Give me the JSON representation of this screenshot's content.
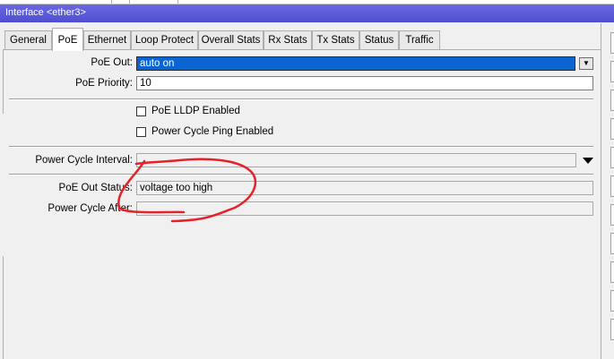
{
  "window": {
    "title": "Interface <ether3>"
  },
  "tabs": [
    {
      "label": "General",
      "active": false
    },
    {
      "label": "PoE",
      "active": true
    },
    {
      "label": "Ethernet",
      "active": false
    },
    {
      "label": "Loop Protect",
      "active": false
    },
    {
      "label": "Overall Stats",
      "active": false
    },
    {
      "label": "Rx Stats",
      "active": false
    },
    {
      "label": "Tx Stats",
      "active": false
    },
    {
      "label": "Status",
      "active": false
    },
    {
      "label": "Traffic",
      "active": false
    }
  ],
  "form": {
    "poe_out_label": "PoE Out:",
    "poe_out_value": "auto on",
    "poe_priority_label": "PoE Priority:",
    "poe_priority_value": "10",
    "poe_lldp_label": "PoE LLDP Enabled",
    "poe_lldp_checked": false,
    "power_cycle_ping_label": "Power Cycle Ping Enabled",
    "power_cycle_ping_checked": false,
    "power_cycle_interval_label": "Power Cycle Interval:",
    "power_cycle_interval_value": "",
    "poe_out_status_label": "PoE Out Status:",
    "poe_out_status_value": "voltage too high",
    "power_cycle_after_label": "Power Cycle After:",
    "power_cycle_after_value": ""
  },
  "colors": {
    "titlebar": "#5a5ad8",
    "selection": "#0a64d2",
    "annotation": "#e8202a"
  },
  "icons": {
    "dropdown": "chevron-down-icon"
  }
}
